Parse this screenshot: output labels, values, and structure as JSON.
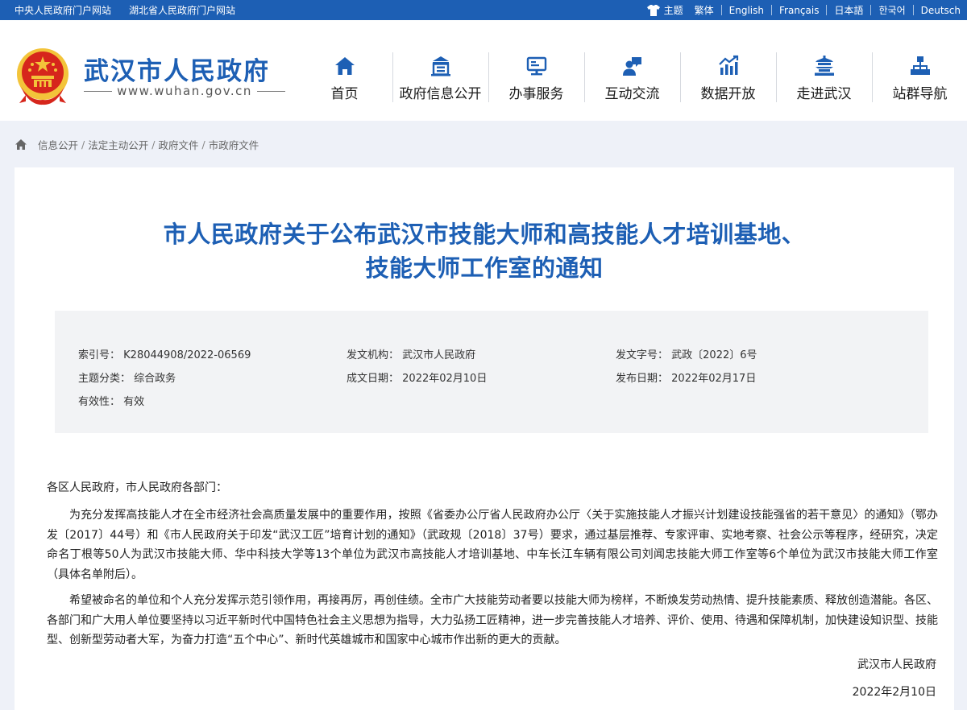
{
  "topbar": {
    "links": [
      "中央人民政府门户网站",
      "湖北省人民政府门户网站"
    ],
    "theme_label": "主题",
    "languages": [
      "繁体",
      "English",
      "Français",
      "日本語",
      "한국어",
      "Deutsch"
    ]
  },
  "header": {
    "site_title": "武汉市人民政府",
    "site_domain": "www.wuhan.gov.cn",
    "nav": [
      {
        "label": "首页",
        "icon": "home-icon"
      },
      {
        "label": "政府信息公开",
        "icon": "building-icon"
      },
      {
        "label": "办事服务",
        "icon": "monitor-icon"
      },
      {
        "label": "互动交流",
        "icon": "chat-user-icon"
      },
      {
        "label": "数据开放",
        "icon": "bar-chart-icon"
      },
      {
        "label": "走进武汉",
        "icon": "pavilion-icon"
      },
      {
        "label": "站群导航",
        "icon": "sitemap-icon"
      }
    ]
  },
  "breadcrumb": [
    "信息公开",
    "法定主动公开",
    "政府文件",
    "市政府文件"
  ],
  "document": {
    "title_line1": "市人民政府关于公布武汉市技能大师和高技能人才培训基地、",
    "title_line2": "技能大师工作室的通知",
    "meta": {
      "index_label": "索引号：",
      "index_value": "K28044908/2022-06569",
      "issuer_label": "发文机构：",
      "issuer_value": "武汉市人民政府",
      "docno_label": "发文字号：",
      "docno_value": "武政〔2022〕6号",
      "topic_label": "主题分类：",
      "topic_value": "综合政务",
      "written_label": "成文日期：",
      "written_value": "2022年02月10日",
      "published_label": "发布日期：",
      "published_value": "2022年02月17日",
      "validity_label": "有效性：",
      "validity_value": "有效"
    },
    "salutation": "各区人民政府，市人民政府各部门：",
    "paragraph1": "为充分发挥高技能人才在全市经济社会高质量发展中的重要作用，按照《省委办公厅省人民政府办公厅〈关于实施技能人才振兴计划建设技能强省的若干意见〉的通知》（鄂办发〔2017〕44号）和《市人民政府关于印发“武汉工匠”培育计划的通知》（武政规〔2018〕37号）要求，通过基层推荐、专家评审、实地考察、社会公示等程序，经研究，决定命名丁根等50人为武汉市技能大师、华中科技大学等13个单位为武汉市高技能人才培训基地、中车长江车辆有限公司刘闻忠技能大师工作室等6个单位为武汉市技能大师工作室（具体名单附后）。",
    "paragraph2": "希望被命名的单位和个人充分发挥示范引领作用，再接再厉，再创佳绩。全市广大技能劳动者要以技能大师为榜样，不断焕发劳动热情、提升技能素质、释放创造潜能。各区、各部门和广大用人单位要坚持以习近平新时代中国特色社会主义思想为指导，大力弘扬工匠精神，进一步完善技能人才培养、评价、使用、待遇和保障机制，加快建设知识型、技能型、创新型劳动者大军，为奋力打造“五个中心”、新时代英雄城市和国家中心城市作出新的更大的贡献。",
    "signature": "武汉市人民政府",
    "date": "2022年2月10日"
  },
  "colors": {
    "brand_blue": "#1d5fb4",
    "emblem_red": "#d6261c",
    "emblem_gold": "#f3c43a",
    "meta_bg": "#f2f3f5",
    "page_bg": "#eef1f8"
  }
}
